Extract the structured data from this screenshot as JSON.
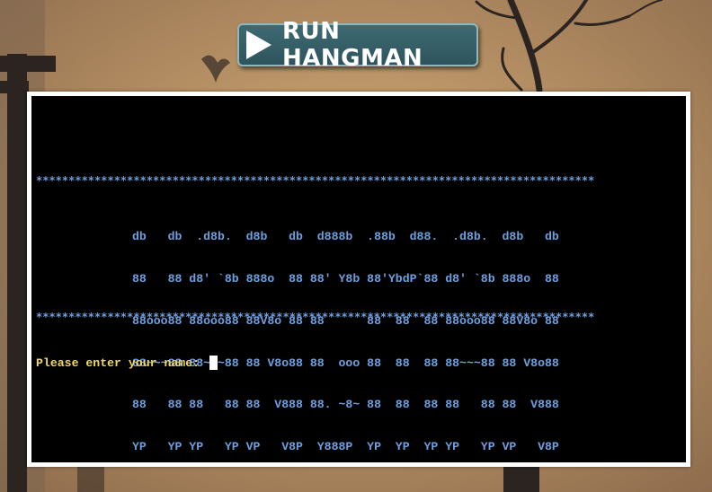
{
  "header": {
    "run_button_label": "RUN HANGMAN"
  },
  "terminal": {
    "divider": "**************************************************************************************",
    "banner_lines": [
      "db   db  .d8b.  d8b   db  d888b  .88b  d88.  .d8b.  d8b   db",
      "88   88 d8' `8b 888o  88 88' Y8b 88'YbdP`88 d8' `8b 888o  88",
      "88ooo88 88ooo88 88V8o 88 88      88  88  88 88ooo88 88V8o 88",
      "88~~~88 88~~~88 88 V8o88 88  ooo 88  88  88 88~~~88 88 V8o88",
      "88   88 88   88 88  V888 88. ~8~ 88  88  88 88   88 88  V888",
      "YP   YP YP   YP VP   V8P  Y888P  YP  YP  YP YP   YP VP   V8P"
    ],
    "prompt": "Please enter your name: "
  },
  "colors": {
    "terminal_bg": "#000000",
    "banner": "#6ea0e0",
    "prompt": "#f0d860",
    "button_bg": "#356069",
    "background": "#b88a5c"
  }
}
